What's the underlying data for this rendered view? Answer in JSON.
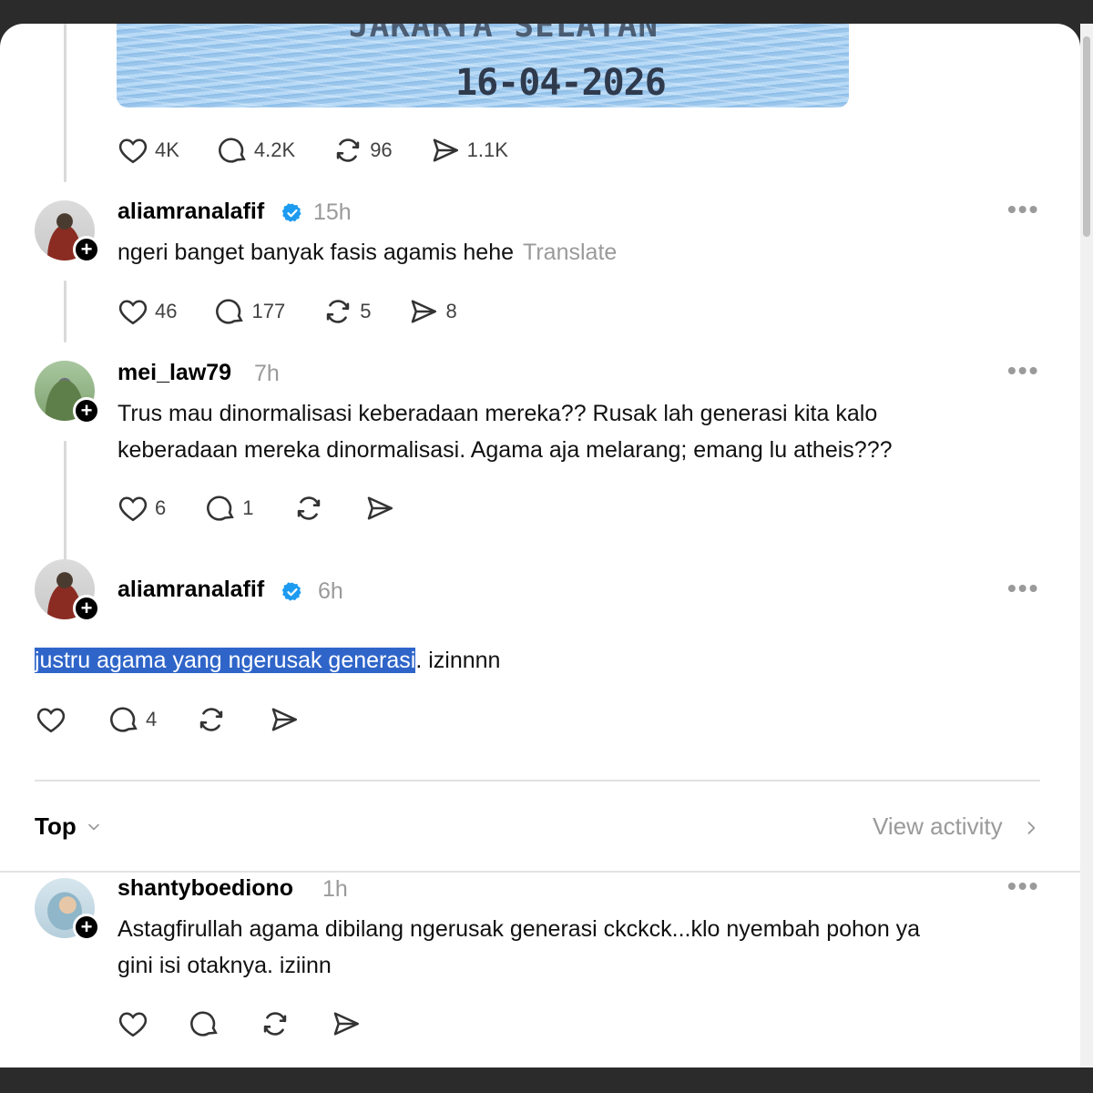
{
  "image_snippet": {
    "text_top": "JAKARTA SELATAN",
    "text_date": "16-04-2026"
  },
  "post_actions": {
    "likes": "4K",
    "replies": "4.2K",
    "reposts": "96",
    "shares": "1.1K"
  },
  "replies": [
    {
      "username": "aliamranalafif",
      "verified": true,
      "time": "15h",
      "text": "ngeri banget banyak fasis agamis hehe",
      "translate_label": "Translate",
      "actions": {
        "likes": "46",
        "replies": "177",
        "reposts": "5",
        "shares": "8"
      }
    },
    {
      "username": "mei_law79",
      "verified": false,
      "time": "7h",
      "text_line1": "Trus mau dinormalisasi keberadaan mereka?? Rusak lah generasi kita kalo",
      "text_line2": "keberadaan mereka dinormalisasi. Agama aja melarang; emang lu atheis???",
      "actions": {
        "likes": "6",
        "replies": "1",
        "reposts": "",
        "shares": ""
      }
    },
    {
      "username": "aliamranalafif",
      "verified": true,
      "time": "6h",
      "text_selected": "justru agama yang ngerusak generasi",
      "text_rest": ". izinnnn",
      "actions": {
        "likes": "",
        "replies": "4",
        "reposts": "",
        "shares": ""
      }
    }
  ],
  "sort": {
    "label": "Top",
    "view_activity": "View activity"
  },
  "comments": [
    {
      "username": "shantyboediono",
      "time": "1h",
      "text_line1": "Astagfirullah agama dibilang ngerusak generasi ckckck...klo nyembah pohon ya",
      "text_line2": "gini isi otaknya. iziinn",
      "actions": {
        "likes": "",
        "replies": "",
        "reposts": "",
        "shares": ""
      }
    }
  ],
  "colors": {
    "verified": "#1d9bf0",
    "selection": "#2f65c9",
    "muted": "#9a9a9a"
  }
}
